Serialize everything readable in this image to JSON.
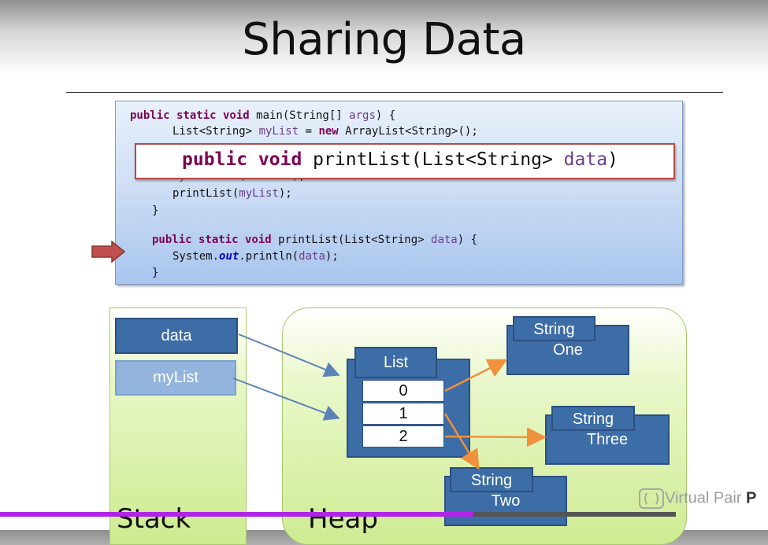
{
  "slide": {
    "title": "Sharing Data",
    "code_lines": [
      "public static void main(String[] args) {",
      "    List<String> myList = new ArrayList<String>();",
      "    myList.add(\"Three\");",
      "    printList(myList);",
      "}",
      "public static void printList(List<String> data) {",
      "    System.out.println(data);",
      "}"
    ],
    "callout": "public void printList(List<String> data)",
    "stack": {
      "label": "Stack",
      "vars": [
        "data",
        "myList"
      ]
    },
    "heap": {
      "label": "Heap",
      "list": {
        "type_label": "List",
        "indices": [
          "0",
          "1",
          "2"
        ]
      },
      "strings": [
        {
          "type_label": "String",
          "value": "One"
        },
        {
          "type_label": "String",
          "value": "Three"
        },
        {
          "type_label": "String",
          "value": "Two"
        }
      ]
    }
  },
  "watermark": {
    "brand_a": "Virtual Pair ",
    "brand_b": "P"
  },
  "player": {
    "progress_fraction": 0.7,
    "played_color": "#b024e6",
    "track_color": "#555555"
  },
  "colors": {
    "keyword": "#7f0055",
    "object_fill": "#3d6da6",
    "arrow_blue": "#5b83b8",
    "arrow_orange": "#f0913c",
    "callout_border": "#b44a4a"
  }
}
